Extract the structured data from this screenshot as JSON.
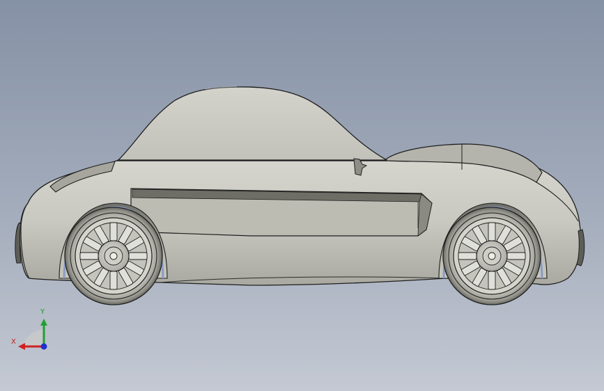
{
  "viewport": {
    "background_top": "#8591a5",
    "background_bottom": "#c4c9d3"
  },
  "model": {
    "body_color": "#c8c8bf",
    "edge_color": "#1e1e1e"
  },
  "triad": {
    "x_label": "X",
    "y_label": "Y",
    "x_color": "#d02020",
    "y_color": "#20a030",
    "z_color": "#2030d0"
  }
}
